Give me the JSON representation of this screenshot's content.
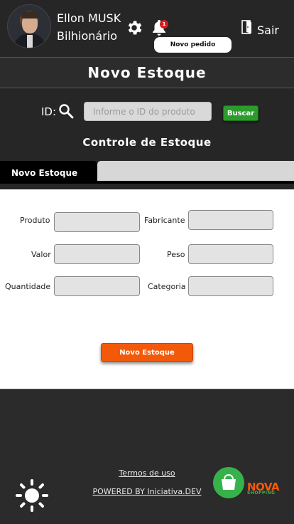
{
  "header": {
    "user_name": "Ellon MUSK",
    "user_title": "Bilhionário",
    "notification_count": "1",
    "notification_toast": "Novo pedido recebido!",
    "exit_label": "Sair"
  },
  "page": {
    "title": "Novo Estoque"
  },
  "search": {
    "id_label": "ID:",
    "placeholder": "Informe o ID do produto",
    "button_label": "Buscar"
  },
  "section": {
    "title": "Controle de Estoque"
  },
  "tabs": [
    {
      "label": "Novo Estoque",
      "active": true
    },
    {
      "label": "",
      "active": false
    }
  ],
  "form": {
    "fields": {
      "produto": "Produto",
      "fabricante": "Fabricante",
      "valor": "Valor",
      "peso": "Peso",
      "quantidade": "Quantidade",
      "categoria": "Categoria"
    },
    "submit_label": "Novo Estoque"
  },
  "footer": {
    "terms": "Termos de uso",
    "powered": "POWERED BY Iniciativa.DEV",
    "logo_word": "NOVA",
    "logo_sub": "SHOPPING"
  },
  "colors": {
    "dark_bg": "#262626",
    "accent_orange": "#f25a0a",
    "accent_green": "#2b9c2b",
    "badge_red": "#d51b1b"
  },
  "icons": [
    "gear-icon",
    "bell-icon",
    "door-icon",
    "search-icon",
    "sun-icon",
    "shopping-bag-icon"
  ]
}
